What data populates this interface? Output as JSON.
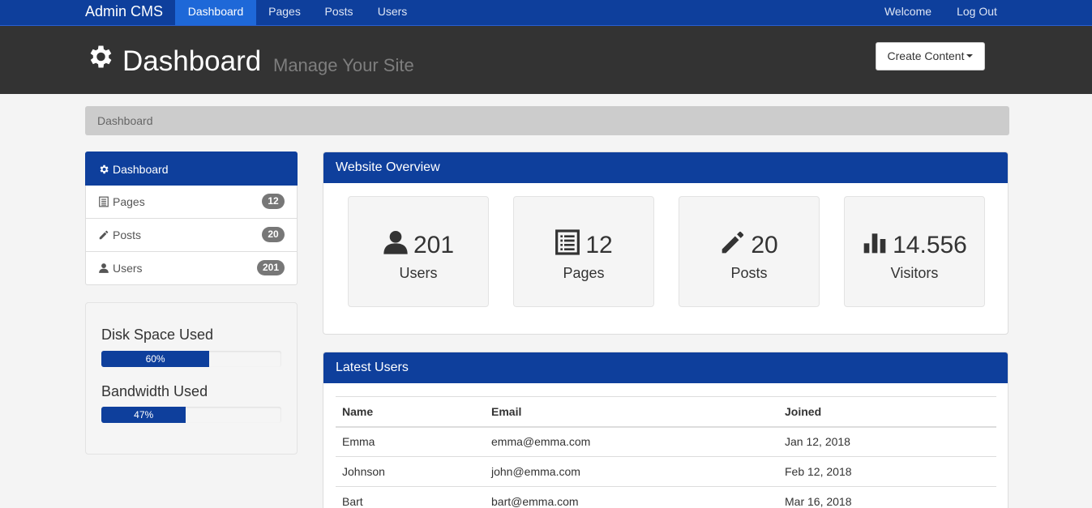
{
  "navbar": {
    "brand": "Admin CMS",
    "links": [
      {
        "label": "Dashboard"
      },
      {
        "label": "Pages"
      },
      {
        "label": "Posts"
      },
      {
        "label": "Users"
      }
    ],
    "right": [
      {
        "label": "Welcome"
      },
      {
        "label": "Log Out"
      }
    ]
  },
  "header": {
    "icon": "gear-icon",
    "title": "Dashboard",
    "subtitle": "Manage Your Site",
    "create_button": "Create Content"
  },
  "breadcrumb": "Dashboard",
  "sidebar": {
    "items": [
      {
        "label": "Dashboard",
        "icon": "gear-icon"
      },
      {
        "label": "Pages",
        "icon": "list-icon",
        "badge": "12"
      },
      {
        "label": "Posts",
        "icon": "pencil-icon",
        "badge": "20"
      },
      {
        "label": "Users",
        "icon": "user-icon",
        "badge": "201"
      }
    ],
    "disk": {
      "label": "Disk Space Used",
      "percent_text": "60%",
      "value": 0.6
    },
    "bandwidth": {
      "label": "Bandwidth Used",
      "percent_text": "47%",
      "value": 0.47
    }
  },
  "overview": {
    "title": "Website Overview",
    "stats": [
      {
        "icon": "user-icon",
        "value": "201",
        "label": "Users"
      },
      {
        "icon": "list-icon",
        "value": "12",
        "label": "Pages"
      },
      {
        "icon": "pencil-icon",
        "value": "20",
        "label": "Posts"
      },
      {
        "icon": "bar-chart-icon",
        "value": "14.556",
        "label": "Visitors"
      }
    ]
  },
  "latest_users": {
    "title": "Latest Users",
    "columns": [
      "Name",
      "Email",
      "Joined"
    ],
    "rows": [
      [
        "Emma",
        "emma@emma.com",
        "Jan 12, 2018"
      ],
      [
        "Johnson",
        "john@emma.com",
        "Feb 12, 2018"
      ],
      [
        "Bart",
        "bart@emma.com",
        "Mar 16, 2018"
      ]
    ]
  },
  "colors": {
    "primary": "#0e3f9c",
    "active_nav": "#1e68d8",
    "header_bg": "#333333",
    "badge": "#777777"
  }
}
